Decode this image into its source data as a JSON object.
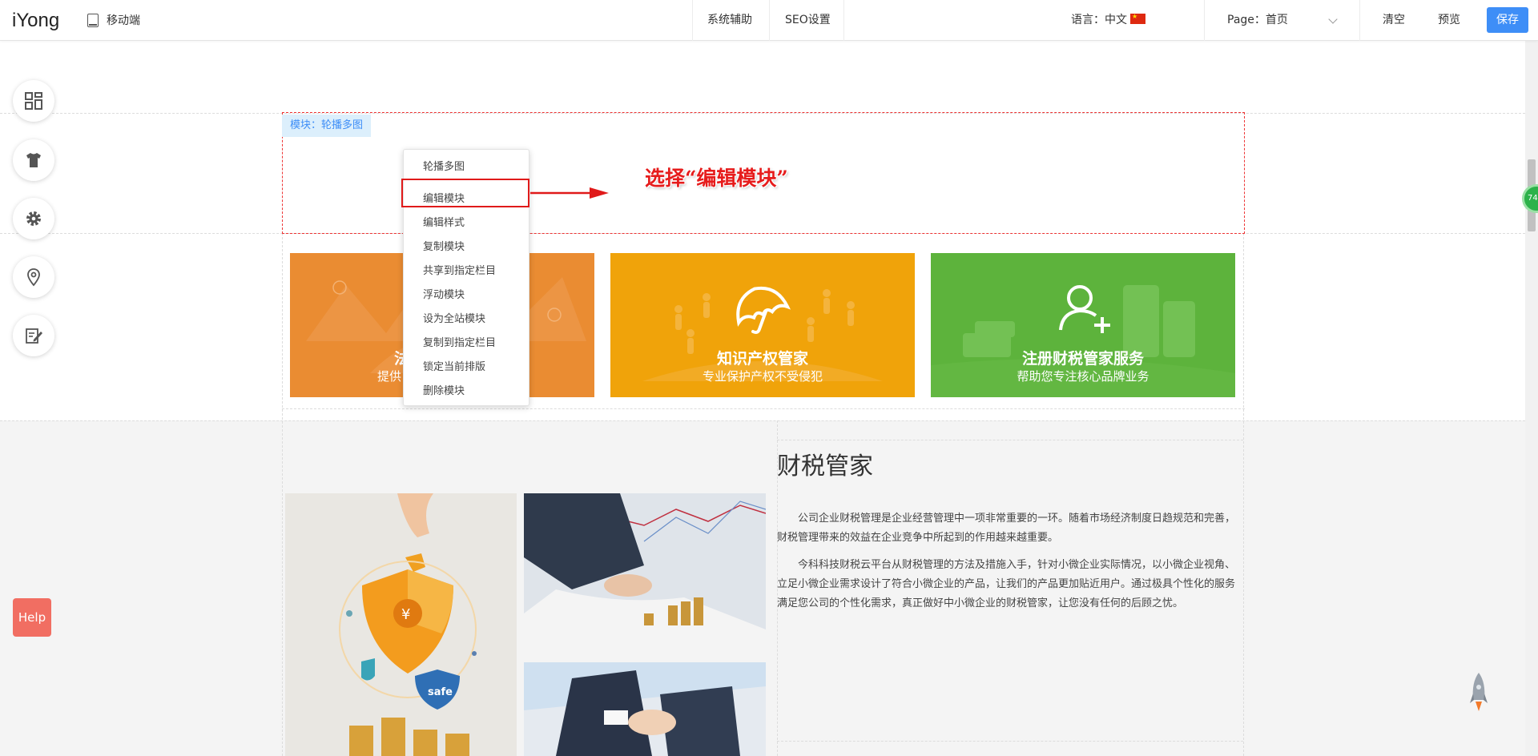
{
  "topbar": {
    "logo": "iYong",
    "mobile_label": "移动端",
    "system_assist": "系统辅助",
    "seo_settings": "SEO设置",
    "language_label": "语言：中文",
    "page_label": "Page：首页",
    "clear_label": "清空",
    "preview_label": "预览",
    "save_label": "保存"
  },
  "sidebar": {
    "items": [
      {
        "icon": "layout-grid-icon"
      },
      {
        "icon": "tshirt-icon"
      },
      {
        "icon": "gear-icon"
      },
      {
        "icon": "map-pin-icon"
      },
      {
        "icon": "edit-note-icon"
      }
    ],
    "help_label": "Help"
  },
  "module": {
    "tag": "模块：轮播多图"
  },
  "context_menu": {
    "items": [
      "轮播多图",
      "编辑模块",
      "编辑样式",
      "复制模块",
      "共享到指定栏目",
      "浮动模块",
      "设为全站模块",
      "复制到指定栏目",
      "锁定当前排版",
      "删除模块"
    ]
  },
  "annotation": {
    "text": "选择“编辑模块”"
  },
  "cards": [
    {
      "title": "法",
      "subtitle": "提供",
      "color": "#ea8c32"
    },
    {
      "title": "知识产权管家",
      "subtitle": "专业保护产权不受侵犯",
      "color": "#f0a30a"
    },
    {
      "title": "注册财税管家服务",
      "subtitle": "帮助您专注核心品牌业务",
      "color": "#5db33c"
    }
  ],
  "about": {
    "title": "财税管家",
    "paragraph1": "公司企业财税管理是企业经营管理中一项非常重要的一环。随着市场经济制度日趋规范和完善，财税管理带来的效益在企业竞争中所起到的作用越来越重要。",
    "paragraph2": "今科科技财税云平台从财税管理的方法及措施入手，针对小微企业实际情况，以小微企业视角、立足小微企业需求设计了符合小微企业的产品，让我们的产品更加贴近用户。通过极具个性化的服务满足您公司的个性化需求，真正做好中小微企业的财税管家，让您没有任何的后顾之忧。",
    "safe_label": "safe",
    "yen_label": "¥"
  },
  "scroll_badge": "74",
  "colors": {
    "accent": "#3e8ef7",
    "help": "#f16e62",
    "annotation": "#e61c1c"
  }
}
